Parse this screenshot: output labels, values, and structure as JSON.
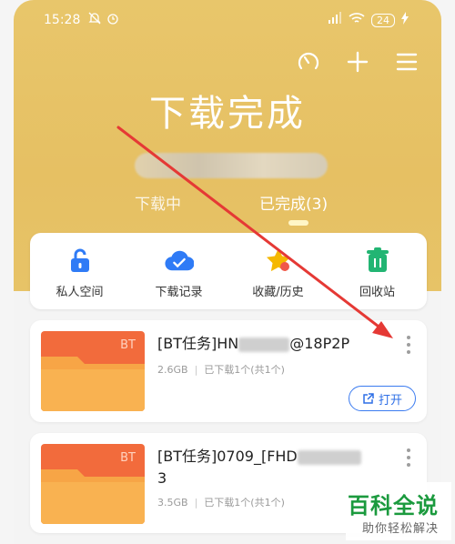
{
  "status_bar": {
    "time": "15:28",
    "battery": "24"
  },
  "header": {
    "title": "下载完成",
    "blurred_text": ""
  },
  "tabs": [
    {
      "label": "下载中",
      "active": false
    },
    {
      "label": "已完成(3)",
      "active": true
    }
  ],
  "quick_actions": [
    {
      "label": "私人空间",
      "icon": "lock-icon",
      "color": "#2f7bf6"
    },
    {
      "label": "下载记录",
      "icon": "cloud-check-icon",
      "color": "#2f7bf6"
    },
    {
      "label": "收藏/历史",
      "icon": "star-icon",
      "color": "#f5b800"
    },
    {
      "label": "回收站",
      "icon": "trash-icon",
      "color": "#22b573"
    }
  ],
  "files": [
    {
      "thumb_badge": "BT",
      "name_prefix": "[BT任务]HN",
      "name_suffix": "@18P2P",
      "size": "2.6GB",
      "progress": "已下载1个(共1个)",
      "open_label": "打开"
    },
    {
      "thumb_badge": "BT",
      "name_prefix": "[BT任务]0709_[FHD",
      "name_suffix": "3",
      "size": "3.5GB",
      "progress": "已下载1个(共1个)"
    }
  ],
  "watermark": {
    "title": "百科全说",
    "subtitle": "助你轻松解决"
  },
  "colors": {
    "header_bg": "#e7c367",
    "accent": "#2e6fe6",
    "thumb": "#f26b3c",
    "annotation_arrow": "#e53935"
  }
}
